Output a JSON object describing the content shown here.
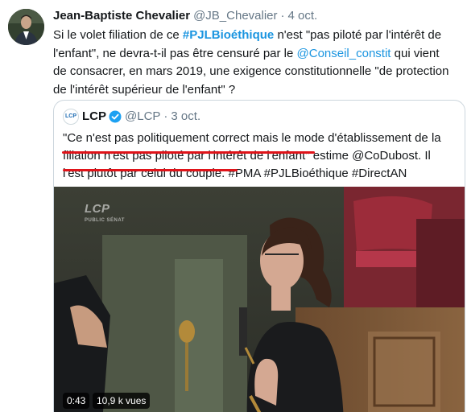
{
  "tweet": {
    "author_name": "Jean-Baptiste Chevalier",
    "handle": "@JB_Chevalier",
    "separator": "·",
    "date": "4 oct.",
    "text": {
      "part1": "Si le volet filiation de ce ",
      "hashtag": "#PJLBioéthique",
      "part2": " n'est \"pas piloté par l'intérêt de l'enfant\", ne devra-t-il pas être censuré par le ",
      "mention": "@Conseil_constit",
      "part3": " qui vient de consacrer, en mars 2019, une exigence constitutionnelle \"de protection de l'intérêt supérieur de l'enfant\" ?"
    }
  },
  "quote": {
    "logo_text": "LCP",
    "name": "LCP",
    "handle": "@LCP",
    "separator": "·",
    "date": "3 oct.",
    "text": {
      "part1": "\"Ce n'est pas politiquement correct mais le mode d'établissement de la ",
      "underlined1": "filiation n'est pas piloté par l'intérêt de l'enfant\"",
      "part2": " estime @CoDubost. Il ",
      "underlined2": "l'est plutôt par celui du couple.",
      "part3": " #PMA #PJLBioéthique #DirectAN"
    },
    "media": {
      "watermark": "LCP",
      "watermark_sub": "PUBLIC SÉNAT",
      "duration": "0:43",
      "views": "10,9 k vues"
    }
  },
  "colors": {
    "link": "#1b95e0",
    "text": "#14171a",
    "muted": "#657786",
    "annotation_red": "#e0141a",
    "verified": "#1da1f2"
  }
}
